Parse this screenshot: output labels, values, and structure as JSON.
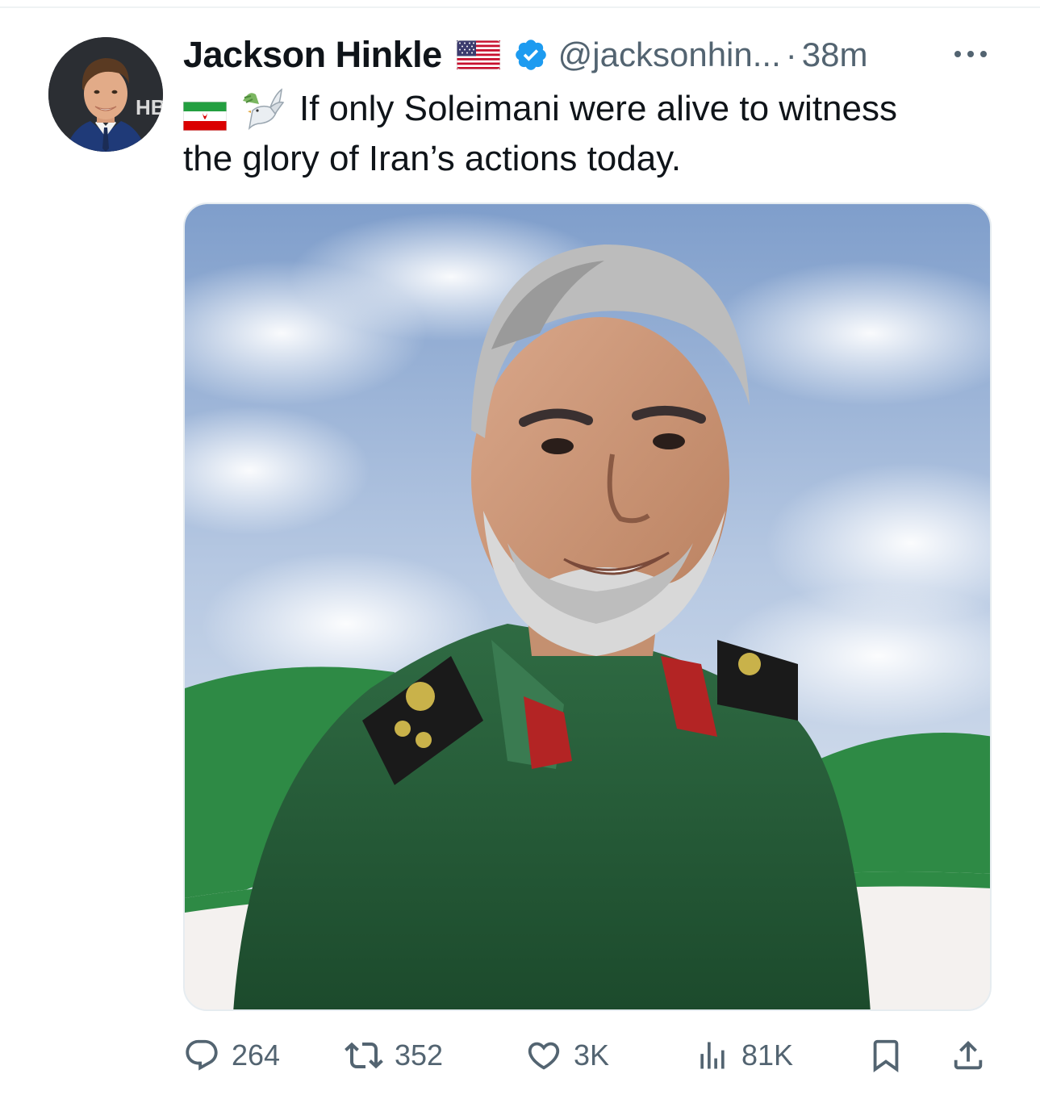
{
  "tweet": {
    "author": {
      "display_name": "Jackson Hinkle",
      "handle": "@jacksonhin...",
      "flag_icon": "us-flag-emoji",
      "verified": true
    },
    "separator": "·",
    "timestamp": "38m",
    "text": {
      "emoji": [
        "iran-flag-emoji",
        "dove-emoji"
      ],
      "line1": "If only Soleimani were alive to witness",
      "line2": "the glory of Iran’s actions today."
    },
    "media": {
      "type": "image",
      "subject": "portrait of Qasem Soleimani in green uniform before Iranian flag and sky"
    },
    "actions": {
      "reply_count": "264",
      "retweet_count": "352",
      "like_count": "3K",
      "view_count": "81K"
    }
  },
  "colors": {
    "text_primary": "#0f1419",
    "text_secondary": "#536471",
    "verified_blue": "#1d9bf0",
    "iran_green": "#239f40",
    "iran_red": "#da0000"
  }
}
